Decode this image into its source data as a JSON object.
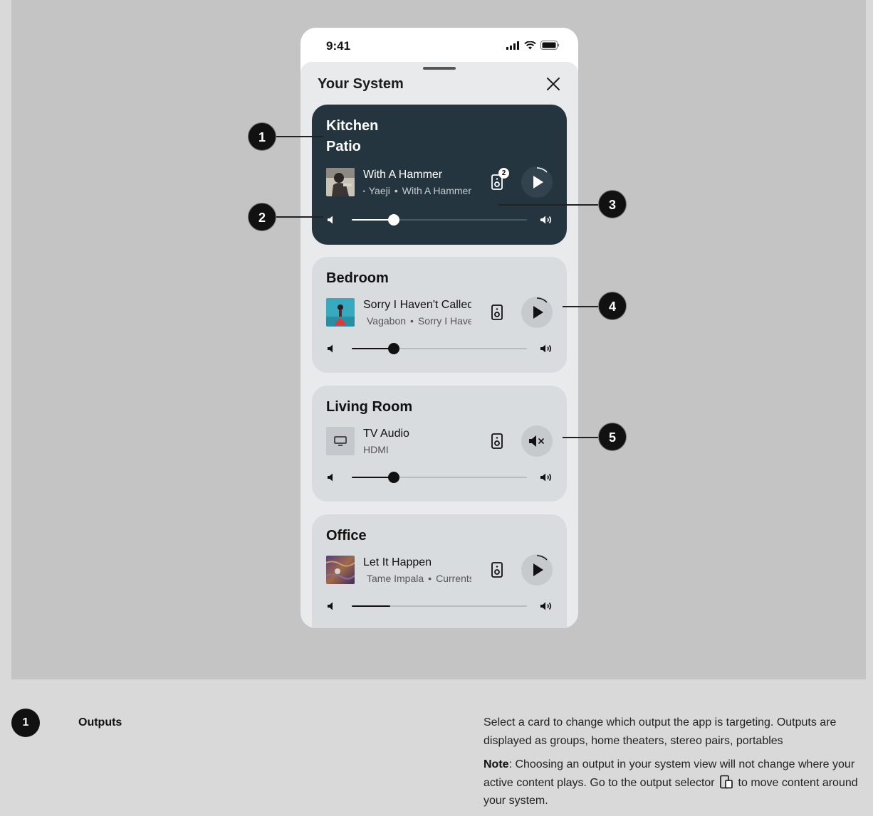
{
  "status_bar": {
    "time": "9:41"
  },
  "sheet": {
    "title": "Your System"
  },
  "cards": [
    {
      "group_lines": [
        "Kitchen",
        "Patio"
      ],
      "track": "With A Hammer",
      "artist": "Yaeji",
      "album": "With A Hammer",
      "service": "apple-music-icon",
      "speaker_count": "2",
      "state": "paused",
      "volume": 0.24
    },
    {
      "group_lines": [
        "Bedroom"
      ],
      "track": "Sorry I Haven't Called",
      "artist": "Vagabon",
      "album": "Sorry I Haven't Called",
      "service": "apple-music-icon",
      "state": "paused",
      "volume": 0.24
    },
    {
      "group_lines": [
        "Living Room"
      ],
      "track": "TV Audio",
      "source": "HDMI",
      "state": "muted",
      "volume": 0.24
    },
    {
      "group_lines": [
        "Office"
      ],
      "track": "Let It Happen",
      "artist": "Tame Impala",
      "album": "Currents",
      "service": "spotify-icon",
      "state": "paused",
      "volume": 0.22
    }
  ],
  "separator": "•",
  "callouts": [
    "1",
    "2",
    "3",
    "4",
    "5"
  ],
  "legend": {
    "number": "1",
    "title": "Outputs",
    "description": "Select a card to change which output the app is targeting. Outputs are displayed as groups, home theaters, stereo pairs, portables",
    "note_label": "Note",
    "note_text_before": ": Choosing an output in your system view will not change where your active content plays. Go to the output selector",
    "note_text_after": " to move content around your system."
  },
  "colors": {
    "active_card": "#25353f",
    "card": "#d9dcdf",
    "sheet": "#e9eaec",
    "canvas": "#c4c4c4"
  }
}
